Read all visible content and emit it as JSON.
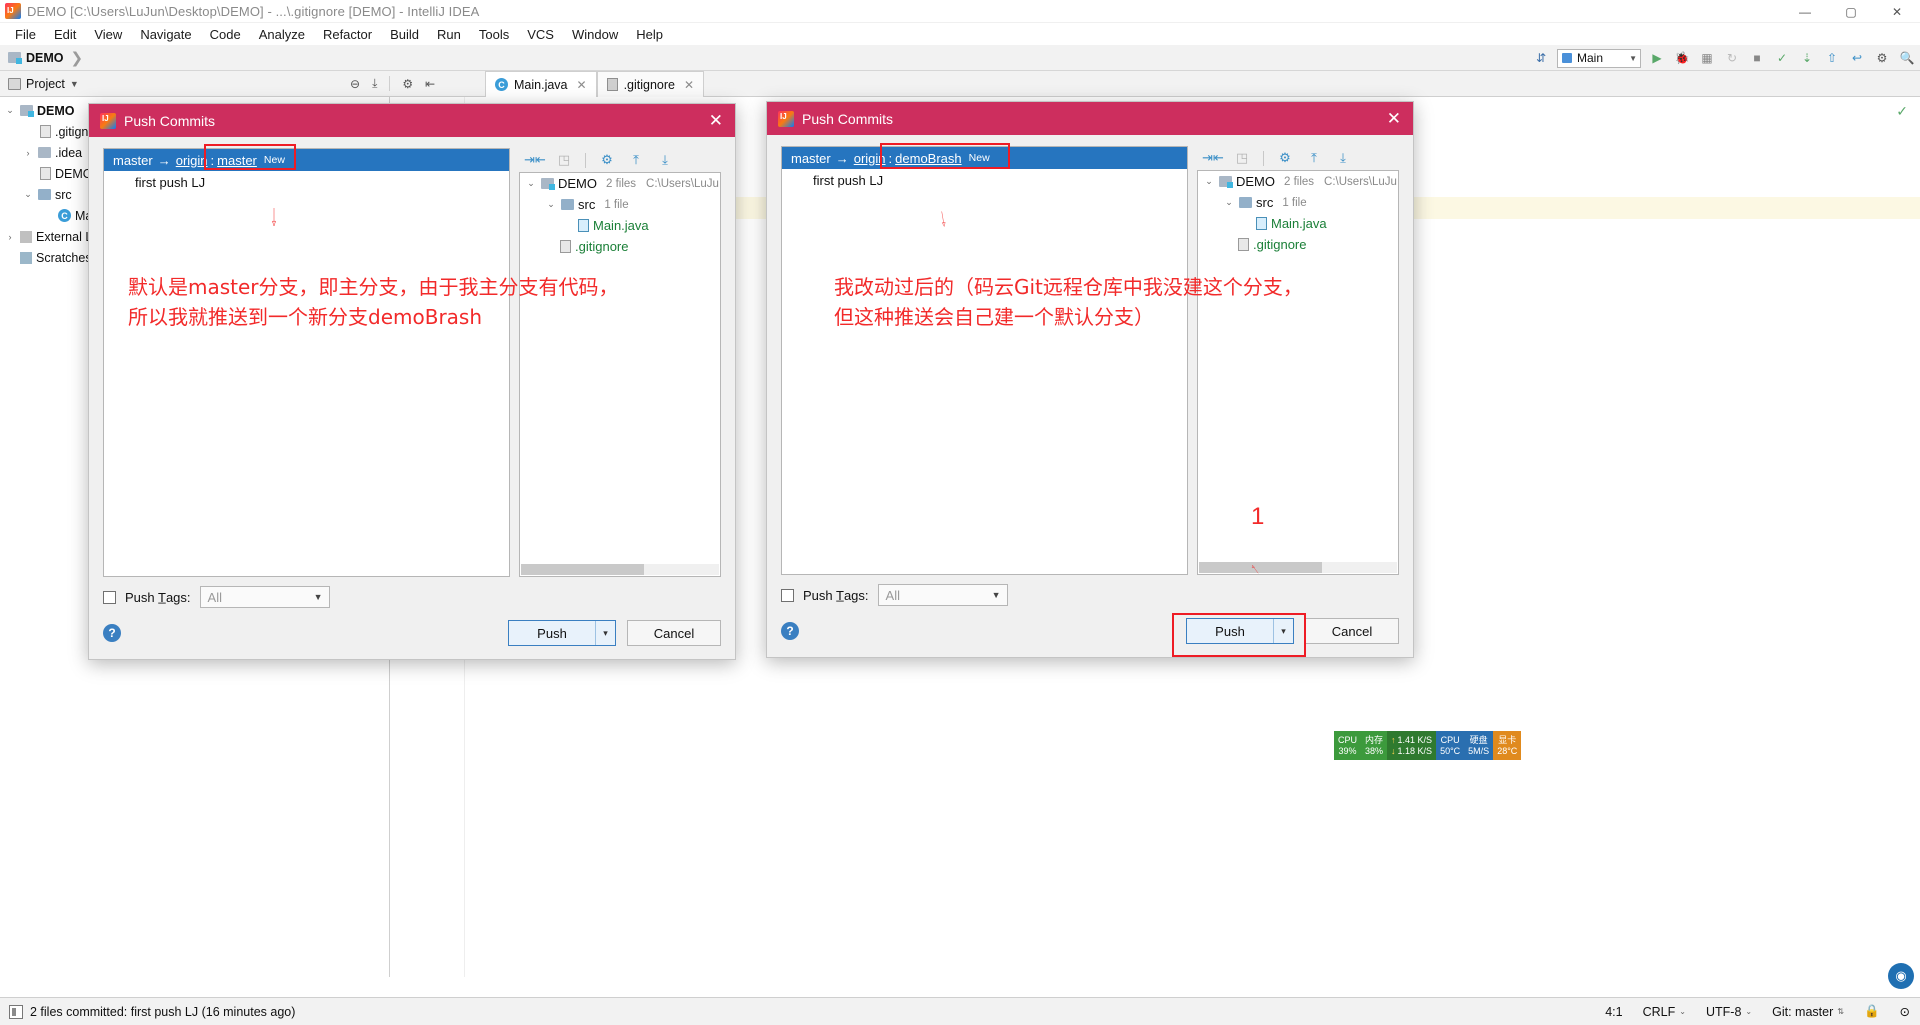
{
  "window": {
    "title": "DEMO [C:\\Users\\LuJun\\Desktop\\DEMO] - ...\\.gitignore [DEMO] - IntelliJ IDEA",
    "minimize": "—",
    "maximize": "▢",
    "close": "✕",
    "app_icon": "intellij-idea-icon"
  },
  "menu": [
    {
      "label": "File"
    },
    {
      "label": "Edit"
    },
    {
      "label": "View"
    },
    {
      "label": "Navigate"
    },
    {
      "label": "Code"
    },
    {
      "label": "Analyze"
    },
    {
      "label": "Refactor"
    },
    {
      "label": "Build"
    },
    {
      "label": "Run"
    },
    {
      "label": "Tools"
    },
    {
      "label": "VCS"
    },
    {
      "label": "Window"
    },
    {
      "label": "Help"
    }
  ],
  "navbar": {
    "crumb": "DEMO",
    "chevron": "❯",
    "run_config": "Main",
    "icons": [
      "update-project-icon",
      "run-icon",
      "debug-icon",
      "coverage-icon",
      "rerun-icon",
      "stop-icon",
      "commit-icon",
      "update-icon",
      "push-icon",
      "undo-icon",
      "settings-icon",
      "search-icon"
    ]
  },
  "toolwindow": {
    "project_label": "Project",
    "project_caret": "▾",
    "actions": [
      "collapse-all-icon",
      "expand-icon",
      "settings-gear-icon",
      "hide-icon"
    ],
    "tabs": [
      {
        "label": "Main.java",
        "icon": "java-class-icon",
        "active": true,
        "close": "✕"
      },
      {
        "label": ".gitignore",
        "icon": "gitignore-file-icon",
        "active": false,
        "close": "✕"
      }
    ]
  },
  "project_tree": [
    {
      "indent": 0,
      "arrow": "⌄",
      "icon": "folder-module-icon",
      "label": "DEMO",
      "bold": true,
      "selected": false
    },
    {
      "indent": 1,
      "arrow": "",
      "icon": "file-icon",
      "label": ".gitignore",
      "bold": false,
      "selected": false
    },
    {
      "indent": 1,
      "arrow": "›",
      "icon": "folder-icon",
      "label": ".idea",
      "bold": false,
      "selected": false
    },
    {
      "indent": 1,
      "arrow": "",
      "icon": "file-icon",
      "label": "DEMO.iml",
      "bold": false,
      "selected": false
    },
    {
      "indent": 1,
      "arrow": "⌄",
      "icon": "folder-src-icon",
      "label": "src",
      "bold": false,
      "selected": false
    },
    {
      "indent": 2,
      "arrow": "",
      "icon": "java-class-icon",
      "label": "Main",
      "bold": false,
      "selected": false
    },
    {
      "indent": 0,
      "arrow": "›",
      "icon": "library-icon",
      "label": "External Libraries",
      "bold": false,
      "selected": false
    },
    {
      "indent": 0,
      "arrow": "",
      "icon": "scratch-icon",
      "label": "Scratches and Consoles",
      "bold": false,
      "selected": false
    }
  ],
  "status_bar": {
    "message": "2 files committed: first push LJ (16 minutes ago)",
    "icon": "event-log-icon",
    "position": "4:1",
    "line_separator": "CRLF",
    "encoding": "UTF-8",
    "git_branch": "Git: master",
    "lock_icon": "lock-icon",
    "inspection_icon": "inspection-icon"
  },
  "cpu_widget": {
    "cpu_label": "CPU",
    "cpu_value": "39%",
    "mem_label": "内存",
    "mem_value": "38%",
    "up_arrow": "↑",
    "up_rate": "1.41 K/S",
    "down_arrow": "↓",
    "down_rate": "1.18 K/S",
    "cpu2_label": "CPU",
    "cpu2_value": "50°C",
    "disk_label": "硬盘",
    "disk_value": "5M/S",
    "gpu_label": "显卡",
    "gpu_value": "28°C"
  },
  "dialog_left": {
    "title": "Push Commits",
    "app_icon": "intellij-idea-icon",
    "close": "✕",
    "branch_from": "master",
    "branch_arrow": "→",
    "remote": "origin",
    "colon": ":",
    "branch_to": "master",
    "new_badge": "New",
    "commit_message": "first push LJ",
    "tree": [
      {
        "indent": 0,
        "arrow": "⌄",
        "icon": "folder-module-icon",
        "label": "DEMO",
        "count": "2 files",
        "path": "C:\\Users\\LuJu",
        "color": "plain"
      },
      {
        "indent": 1,
        "arrow": "⌄",
        "icon": "folder-src-icon",
        "label": "src",
        "count": "1 file",
        "path": "",
        "color": "plain"
      },
      {
        "indent": 2,
        "arrow": "",
        "icon": "java-class-icon",
        "label": "Main.java",
        "count": "",
        "path": "",
        "color": "green"
      },
      {
        "indent": 1,
        "arrow": "",
        "icon": "gitignore-file-icon",
        "label": ".gitignore",
        "count": "",
        "path": "",
        "color": "green"
      }
    ],
    "toolbar_icons": [
      "collapse-all-icon",
      "show-diff-icon",
      "settings-gear-icon",
      "group-by-directory-icon",
      "expand-all-icon"
    ],
    "push_tags_label": "Push T̲ags:",
    "push_tags_value": "All",
    "help": "?",
    "push_button": "Push",
    "push_dropdown": "▾",
    "cancel_button": "Cancel"
  },
  "dialog_right": {
    "title": "Push Commits",
    "app_icon": "intellij-idea-icon",
    "close": "✕",
    "branch_from": "master",
    "branch_arrow": "→",
    "remote": "origin",
    "colon": ":",
    "branch_to": "demoBrash",
    "new_badge": "New",
    "commit_message": "first push LJ",
    "tree": [
      {
        "indent": 0,
        "arrow": "⌄",
        "icon": "folder-module-icon",
        "label": "DEMO",
        "count": "2 files",
        "path": "C:\\Users\\LuJu",
        "color": "plain"
      },
      {
        "indent": 1,
        "arrow": "⌄",
        "icon": "folder-src-icon",
        "label": "src",
        "count": "1 file",
        "path": "",
        "color": "plain"
      },
      {
        "indent": 2,
        "arrow": "",
        "icon": "java-class-icon",
        "label": "Main.java",
        "count": "",
        "path": "",
        "color": "green"
      },
      {
        "indent": 1,
        "arrow": "",
        "icon": "gitignore-file-icon",
        "label": ".gitignore",
        "count": "",
        "path": "",
        "color": "green"
      }
    ],
    "toolbar_icons": [
      "collapse-all-icon",
      "show-diff-icon",
      "settings-gear-icon",
      "group-by-directory-icon",
      "expand-all-icon"
    ],
    "push_tags_label": "Push T̲ags:",
    "push_tags_value": "All",
    "help": "?",
    "push_button": "Push",
    "push_dropdown": "▾",
    "cancel_button": "Cancel"
  },
  "annotations": {
    "left_line1": "默认是master分支，即主分支，由于我主分支有代码，",
    "left_line2": "所以我就推送到一个新分支demoBrash",
    "right_line1": "我改动过后的（码云Git远程仓库中我没建这个分支，",
    "right_line2": "但这种推送会自己建一个默认分支）",
    "step_number": "1",
    "color": "#f22a2a"
  }
}
